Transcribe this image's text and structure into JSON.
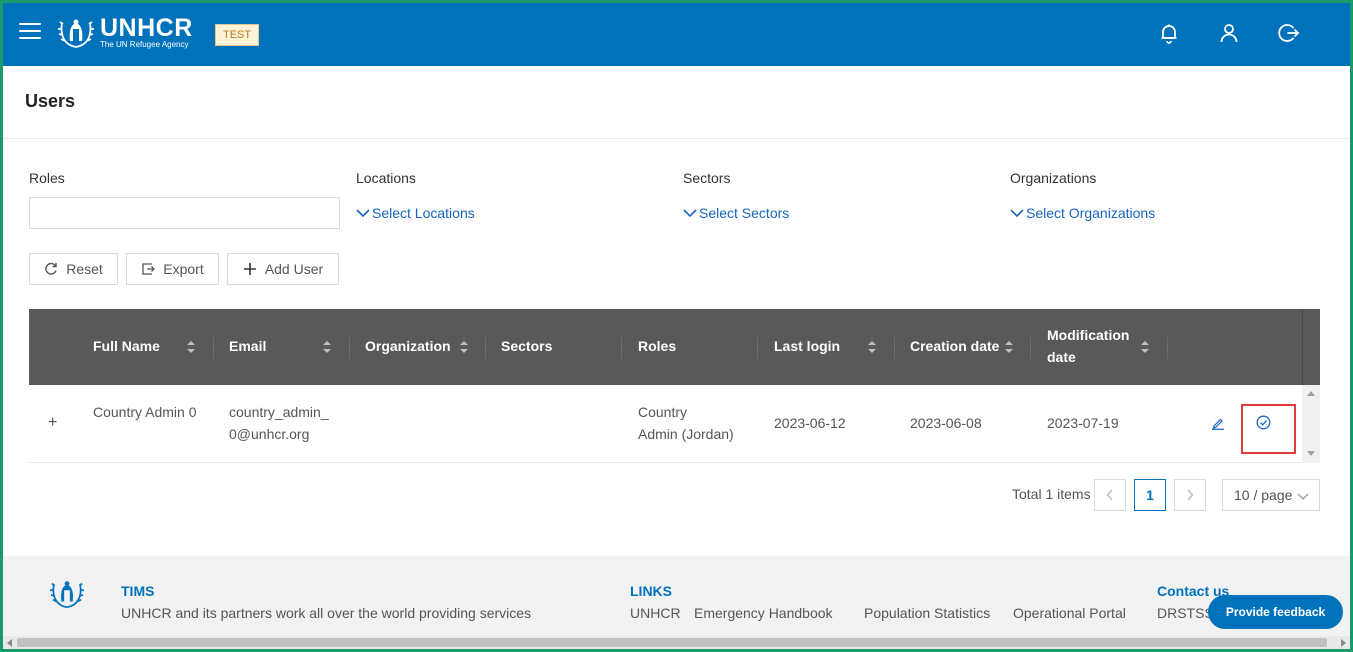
{
  "header": {
    "logo_name": "UNHCR",
    "logo_sub": "The UN Refugee Agency",
    "env_badge": "TEST",
    "brand_color": "#0072bc"
  },
  "page": {
    "title": "Users"
  },
  "filters": {
    "roles_label": "Roles",
    "locations_label": "Locations",
    "locations_select": "Select Locations",
    "sectors_label": "Sectors",
    "sectors_select": "Select Sectors",
    "organizations_label": "Organizations",
    "organizations_select": "Select Organizations"
  },
  "toolbar": {
    "reset_label": "Reset",
    "export_label": "Export",
    "add_user_label": "Add User"
  },
  "table": {
    "columns": [
      "Full Name",
      "Email",
      "Organization",
      "Sectors",
      "Roles",
      "Last login",
      "Creation date",
      "Modification date"
    ],
    "modification_line1": "Modification",
    "modification_line2": "date",
    "rows": [
      {
        "expand": "+",
        "full_name": "Country Admin 0",
        "email_line1": "country_admin_",
        "email_line2": "0@unhcr.org",
        "organization": "",
        "sectors": "",
        "roles_line1": "Country",
        "roles_line2": "Admin (Jordan)",
        "last_login": "2023-06-12",
        "creation_date": "2023-06-08",
        "modification_date": "2023-07-19"
      }
    ]
  },
  "pagination": {
    "total": "Total 1 items",
    "current_page": "1",
    "page_size": "10 / page"
  },
  "footer": {
    "tims_title": "TIMS",
    "tims_text": "UNHCR and its partners work all over the world providing services",
    "links_title": "LINKS",
    "links": [
      "UNHCR",
      "Emergency Handbook",
      "Population Statistics",
      "Operational Portal"
    ],
    "contact_title": "Contact us",
    "contact_text": "DRSTSS",
    "feedback_label": "Provide feedback"
  }
}
